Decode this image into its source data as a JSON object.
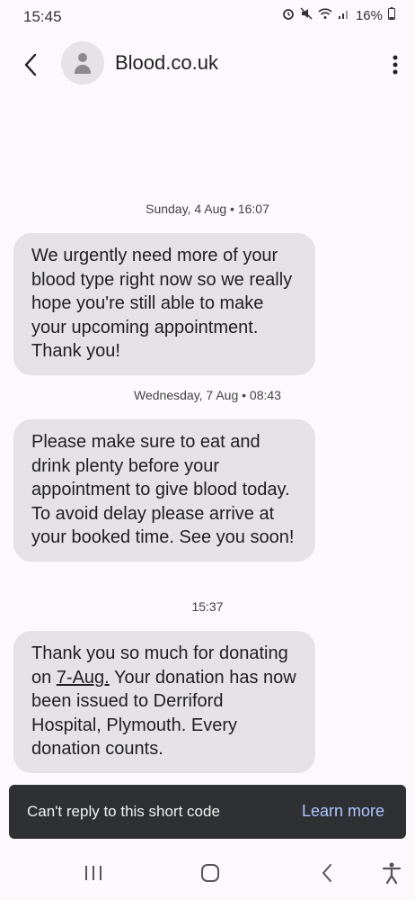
{
  "status_bar": {
    "time": "15:45",
    "battery": "16%"
  },
  "header": {
    "contact_name": "Blood.co.uk"
  },
  "messages": [
    {
      "timestamp": "Sunday, 4 Aug • 16:07",
      "text": "We urgently need more of your blood type right now so we really hope you're still able to make your upcoming appointment. Thank you!"
    },
    {
      "timestamp": "Wednesday, 7 Aug • 08:43",
      "text": "Please make sure to eat and drink plenty before your appointment to give blood today. To avoid delay please arrive at your booked time. See you soon!"
    },
    {
      "timestamp": "15:37",
      "text_before": "Thank you so much for donating on ",
      "link": "7-Aug.",
      "text_after": " Your donation has now been issued to Derriford Hospital, Plymouth. Every donation counts."
    }
  ],
  "snackbar": {
    "message": "Can't reply to this short code",
    "action": "Learn more"
  },
  "colors": {
    "background": "#fcf8fc",
    "bubble": "#e4e2e7",
    "snackbar": "#2f3033",
    "snackbar_action": "#aec6ff"
  }
}
